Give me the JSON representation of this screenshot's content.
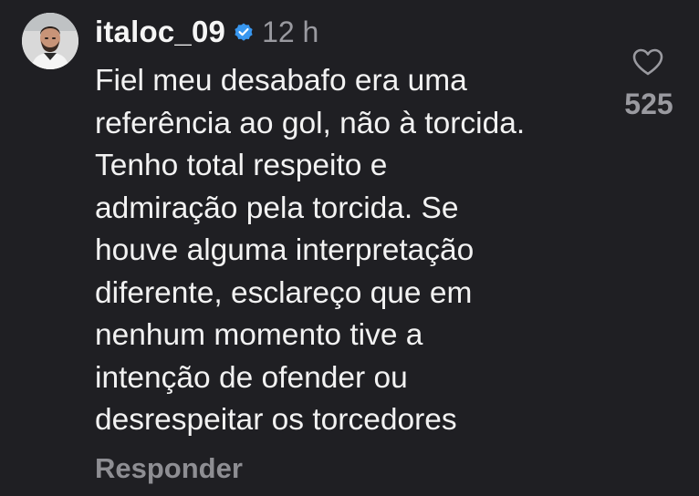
{
  "comment": {
    "username": "italoc_09",
    "verified": true,
    "time": "12 h",
    "text": "Fiel meu desabafo era uma\nreferência ao gol, não à torcida.\nTenho total respeito e\nadmiração pela torcida. Se\nhouve alguma interpretação\ndiferente, esclareço que em\nnenhum momento tive a\nintenção de ofender ou\ndesrespeitar os torcedores",
    "reply_label": "Responder",
    "like_icon": "heart-outline-icon",
    "like_count": "525"
  },
  "colors": {
    "background": "#1f1f23",
    "text": "#f2f2f2",
    "muted": "#9a9aa0",
    "verified_badge": "#3897f0"
  }
}
